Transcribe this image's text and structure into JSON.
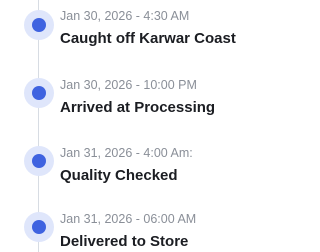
{
  "timeline": {
    "events": [
      {
        "date": "Jan 30, 2026 - 4:30 AM",
        "title": "Caught off Karwar Coast"
      },
      {
        "date": "Jan 30, 2026 - 10:00 PM",
        "title": "Arrived at Processing"
      },
      {
        "date": "Jan 31, 2026 - 4:00 Am:",
        "title": "Quality Checked"
      },
      {
        "date": "Jan 31, 2026 - 06:00 AM",
        "title": "Delivered to Store"
      }
    ],
    "colors": {
      "accent": "#3f63e0",
      "accent_halo": "#dfe6fb",
      "rail": "#d7dce3",
      "date_text": "#8a8f98",
      "title_text": "#1b1d22"
    }
  }
}
